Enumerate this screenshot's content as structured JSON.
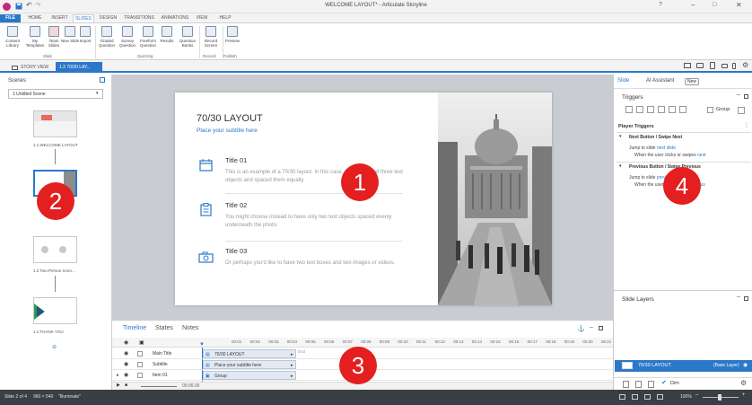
{
  "window": {
    "title": "WELCOME LAYOUT* - Articulate Storyline",
    "tab_file": "FILE"
  },
  "ribbon": {
    "tabs": [
      "HOME",
      "INSERT",
      "SLIDES",
      "DESIGN",
      "TRANSITIONS",
      "ANIMATIONS",
      "VIEW",
      "HELP"
    ],
    "buttons": [
      {
        "label": "Content Library",
        "icon": "content-library-icon"
      },
      {
        "label": "My Templates",
        "icon": "templates-icon"
      },
      {
        "label": "Team Slides",
        "icon": "team-slides-icon"
      },
      {
        "label": "New Slide",
        "icon": "new-slide-icon"
      },
      {
        "label": "Import",
        "icon": "import-icon"
      },
      {
        "label": "Graded Question",
        "icon": "graded-question-icon"
      },
      {
        "label": "Survey Question",
        "icon": "survey-question-icon"
      },
      {
        "label": "Freeform Question",
        "icon": "freeform-question-icon"
      },
      {
        "label": "Results",
        "icon": "results-icon"
      },
      {
        "label": "Question Banks",
        "icon": "question-banks-icon"
      },
      {
        "label": "Record Screen",
        "icon": "record-screen-icon"
      },
      {
        "label": "Preview",
        "icon": "preview-icon"
      }
    ],
    "groups": [
      "Slide",
      "Quizzing",
      "Record",
      "Publish"
    ]
  },
  "doctabs": [
    "STORY VIEW",
    "1.2 70/30 LAY..."
  ],
  "scenes": {
    "header": "Scenes",
    "selected": "1 Untitled Scene",
    "slides": [
      "1.1 WELCOME LAYOUT",
      "",
      "1.3 Two-Person Scen...",
      "1.4 THANK YOU"
    ]
  },
  "slide": {
    "title": "70/30 LAYOUT",
    "subtitle": "Place your subtitle here",
    "items": [
      {
        "heading": "Title 01",
        "body": "This is an example of a 70/30 layout. In this case, we've inserted three text objects and spaced them equally."
      },
      {
        "heading": "Title 02",
        "body": "You might choose instead to have only two text objects spaced evenly underneath the photo."
      },
      {
        "heading": "Title 03",
        "body": "Or perhaps you'd like to have two text boxes and two images or videos."
      }
    ]
  },
  "timeline": {
    "tabs": [
      "Timeline",
      "States",
      "Notes"
    ],
    "ticks": [
      "00:01",
      "00:02",
      "00:03",
      "00:04",
      "00:05",
      "00:06",
      "00:07",
      "00:08",
      "00:09",
      "00:10",
      "00:11",
      "00:12",
      "00:13",
      "00:14",
      "00:15",
      "00:16",
      "00:17",
      "00:18",
      "00:19",
      "00:20",
      "00:21"
    ],
    "rows": [
      {
        "name": "Main Title",
        "bar": "70/30 LAYOUT"
      },
      {
        "name": "Subtitle",
        "bar": "Place your subtitle here"
      },
      {
        "name": "Item 01",
        "bar": "Group"
      }
    ],
    "end_label": "End",
    "time": "00:05.00"
  },
  "right_panel": {
    "tabs": [
      "Slide",
      "AI Assistant"
    ],
    "new_badge": "New",
    "triggers_header": "Triggers",
    "group_label": "Group",
    "player_triggers": "Player Triggers",
    "next_section": "Next Button / Swipe Next",
    "next_action": "Jump to slide",
    "next_action_link": "next slide",
    "next_when": "When the user clicks or swipes",
    "next_when_link": "next",
    "prev_section": "Previous Button / Swipe Previous",
    "prev_action": "Jump to slide",
    "prev_action_link": "previous slide",
    "prev_when": "When the user cli",
    "prev_when_link": "previous",
    "layers_header": "Slide Layers",
    "base_layer": "70/30 LAYOUT",
    "base_layer_tag": "(Base Layer)",
    "dim_label": "Dim"
  },
  "status": {
    "slide": "Slide 2 of 4",
    "size": "960 × 540",
    "theme": "\"Illuminate\"",
    "zoom": "100%"
  },
  "callouts": [
    "1",
    "2",
    "3",
    "4"
  ],
  "colors": {
    "accent": "#2b78c8",
    "callout": "#e41f1f"
  }
}
